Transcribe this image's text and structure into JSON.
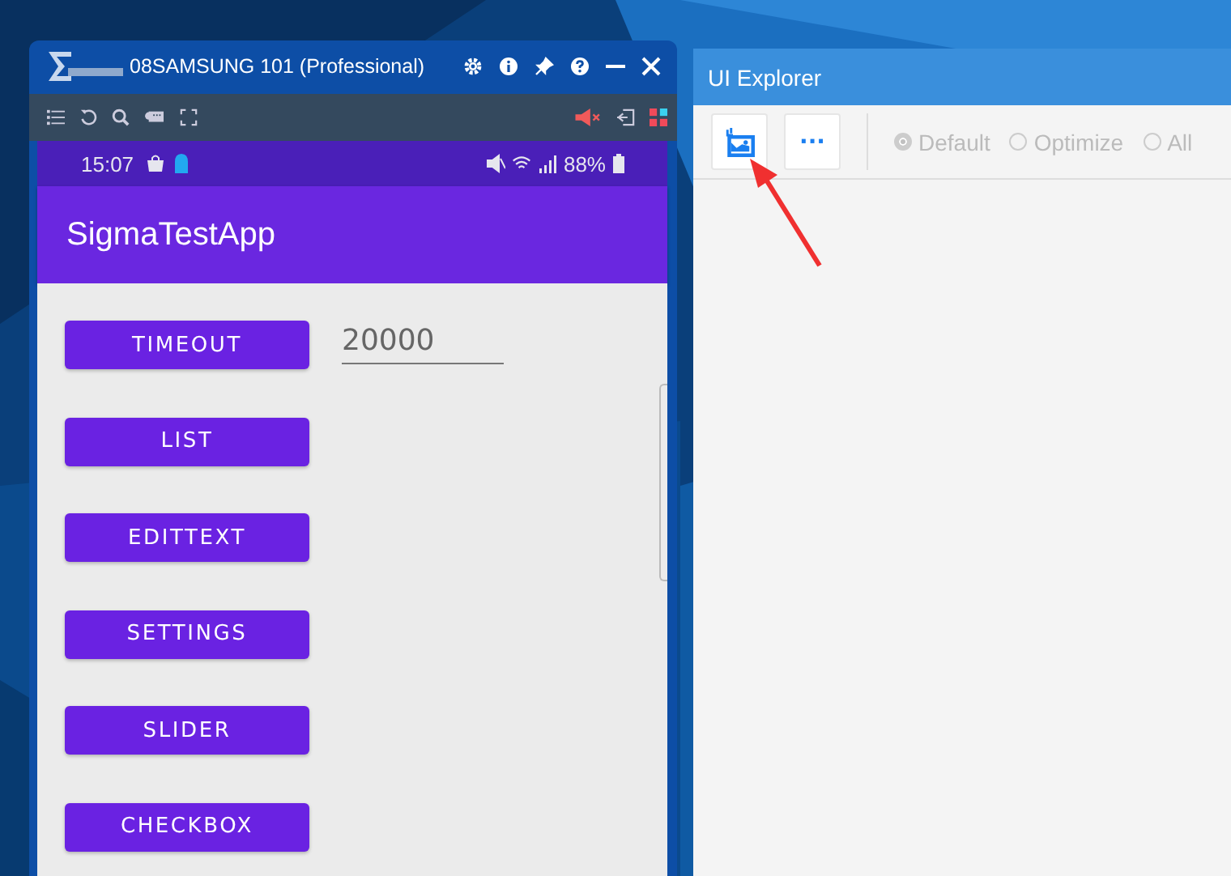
{
  "mirror_window": {
    "title": "08SAMSUNG 101 (Professional)",
    "status_bar": {
      "time": "15:07",
      "battery": "88%"
    },
    "app_bar": {
      "title": "SigmaTestApp"
    },
    "buttons": [
      "TIMEOUT",
      "LIST",
      "EDITTEXT",
      "SETTINGS",
      "SLIDER",
      "CHECKBOX"
    ],
    "timeout_field": {
      "value": "20000"
    }
  },
  "explorer_window": {
    "title": "UI Explorer",
    "more_button": "···",
    "modes": [
      {
        "label": "Default",
        "selected": true
      },
      {
        "label": "Optimize",
        "selected": false
      },
      {
        "label": "All",
        "selected": false
      }
    ]
  }
}
